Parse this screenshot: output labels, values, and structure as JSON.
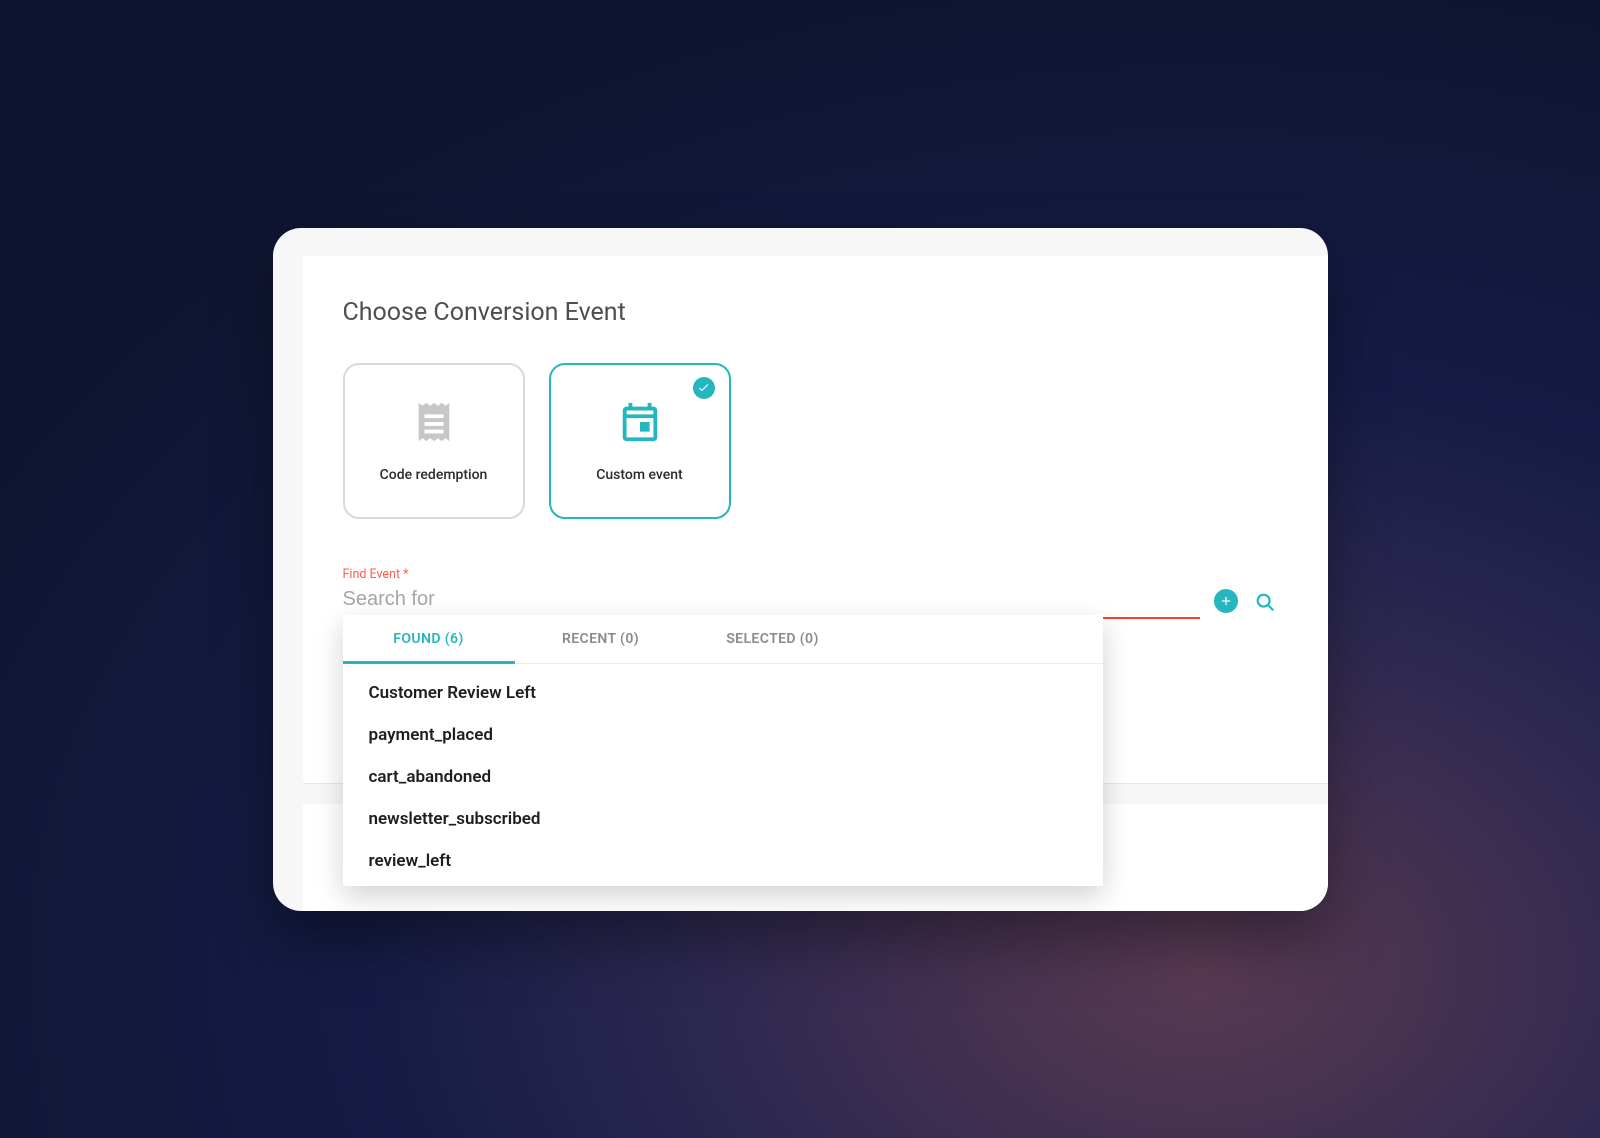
{
  "title": "Choose Conversion Event",
  "options": {
    "code_redemption": {
      "label": "Code redemption",
      "icon": "receipt-icon",
      "selected": false
    },
    "custom_event": {
      "label": "Custom event",
      "icon": "calendar-icon",
      "selected": true
    }
  },
  "find_event": {
    "label": "Find Event *",
    "placeholder": "Search for",
    "value": ""
  },
  "dropdown": {
    "tabs": {
      "found": {
        "label": "FOUND (6)",
        "active": true
      },
      "recent": {
        "label": "RECENT (0)",
        "active": false
      },
      "selected": {
        "label": "SELECTED (0)",
        "active": false
      }
    },
    "results": [
      "Customer Review Left",
      "payment_placed",
      "cart_abandoned",
      "newsletter_subscribed",
      "review_left"
    ]
  },
  "colors": {
    "accent": "#26b6c0",
    "error": "#ff3b2f"
  }
}
